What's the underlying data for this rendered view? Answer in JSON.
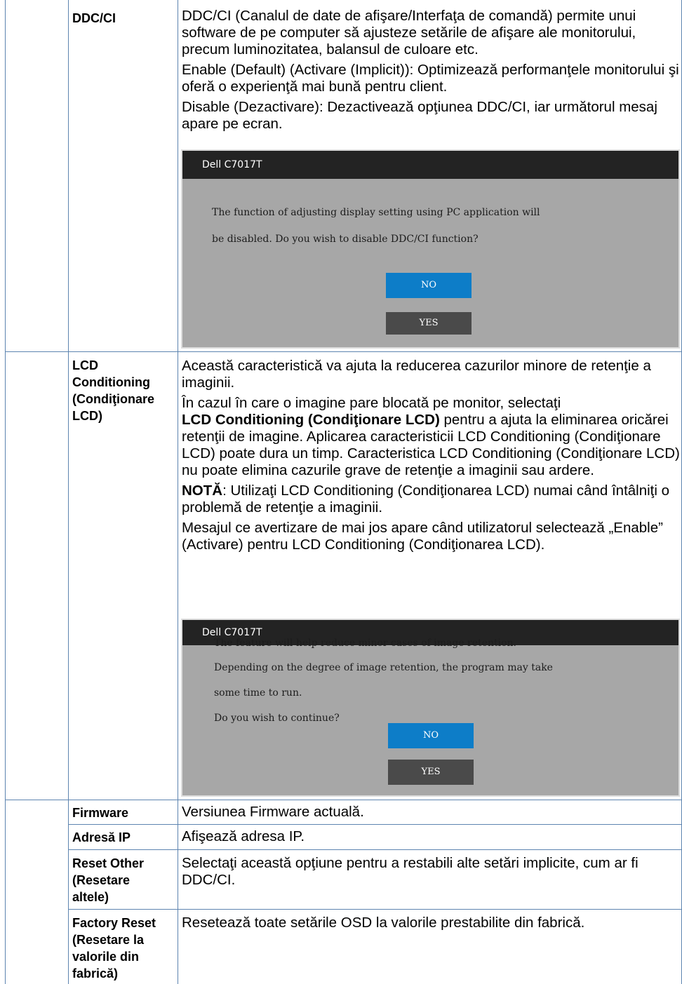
{
  "rows": {
    "ddcci": {
      "label": "DDC/CI",
      "p1": "DDC/CI (Canalul de date de afişare/Interfaţa de comandă) permite unui software de pe computer să ajusteze setările de afişare ale monitorului, precum luminozitatea, balansul de culoare etc.",
      "p2": "Enable (Default) (Activare (Implicit)): Optimizează performanţele monitorului şi oferă o experienţă mai bună pentru client.",
      "p3": "Disable (Dezactivare): Dezactivează opţiunea DDC/CI, iar următorul mesaj apare pe ecran.",
      "osd": {
        "title": "Dell C7017T",
        "line1": "The function of adjusting display setting using PC application will",
        "line2": "be disabled. Do you wish to disable DDC/CI function?",
        "no": "NO",
        "yes": "YES"
      }
    },
    "lcd": {
      "label_1": "LCD",
      "label_2": "Conditioning",
      "label_3": "(Condiţionare",
      "label_4": "LCD)",
      "p1": "Această caracteristică va ajuta la reducerea cazurilor minore de retenţie a imaginii.",
      "p2_a": "În cazul în care o imagine pare blocată pe monitor, selectaţi",
      "p2_bold": "LCD Conditioning (Condiţionare LCD)",
      "p2_b": " pentru a ajuta la eliminarea oricărei retenţii de imagine. Aplicarea caracteristicii LCD Conditioning (Condiţionare LCD) poate dura un timp. Caracteristica LCD Conditioning (Condiţionare LCD) nu poate elimina cazurile grave de retenţie a imaginii sau ardere.",
      "note_bold": "NOTĂ",
      "note_text": ": Utilizaţi LCD Conditioning (Condiţionarea LCD) numai când întâlniţi o problemă de retenţie a imaginii.",
      "p4": "Mesajul ce avertizare de mai jos apare când utilizatorul selectează „Enable” (Activare) pentru LCD Conditioning (Condiţionarea LCD).",
      "osd": {
        "title": "Dell C7017T",
        "line1": "The feature will help reduce minor cases of image retention.",
        "line2": "Depending on the degree of image retention, the program may take",
        "line3": "some time to run.",
        "line4": "Do you wish to continue?",
        "no": "NO",
        "yes": "YES"
      }
    },
    "firmware": {
      "label": "Firmware",
      "text": "Versiunea Firmware actuală."
    },
    "ip": {
      "label": "Adresă IP",
      "text": "Afişează adresa IP."
    },
    "reset_other": {
      "label_1": "Reset Other",
      "label_2": "(Resetare",
      "label_3": "altele)",
      "text": "Selectaţi această opţiune pentru a restabili alte setări implicite, cum ar fi DDC/CI."
    },
    "factory_reset": {
      "label_1": "Factory Reset",
      "label_2": "(Resetare la",
      "label_3": "valorile din",
      "label_4": "fabrică)",
      "text": "Resetează toate setările OSD la valorile prestabilite din fabrică."
    }
  }
}
